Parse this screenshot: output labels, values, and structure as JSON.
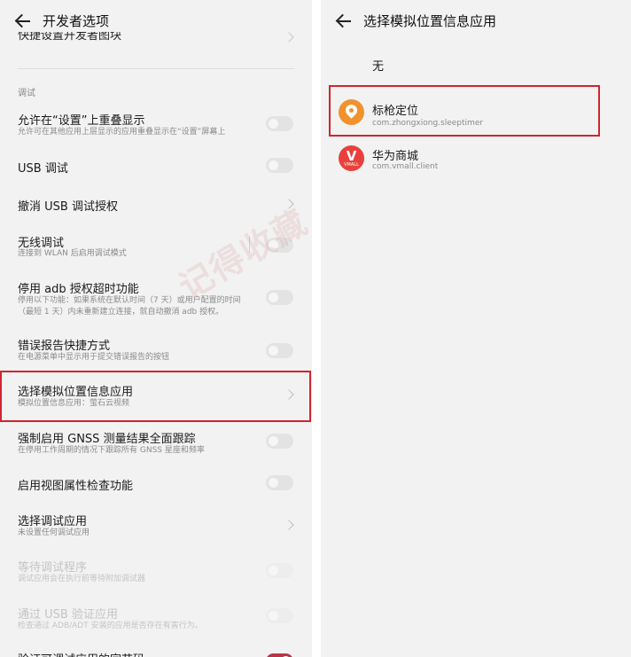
{
  "left": {
    "title": "开发者选项",
    "cut_item": "快捷设置开发者图块",
    "section": "调试",
    "rows": [
      {
        "title": "允许在“设置”上重叠显示",
        "sub": "允许可在其他应用上层显示的应用重叠显示在“设置”屏幕上",
        "control": "toggle",
        "state": "off"
      },
      {
        "title": "USB 调试",
        "control": "toggle",
        "state": "off"
      },
      {
        "title": "撤消 USB 调试授权",
        "control": "chevron"
      },
      {
        "title": "无线调试",
        "sub": "连接到 WLAN 后启用调试模式",
        "control": "toggle",
        "state": "off"
      },
      {
        "title": "停用 adb 授权超时功能",
        "sub": "停用以下功能：如果系统在默认时间（7 天）或用户配置的时间",
        "sub2": "（最短 1 天）内未重新建立连接，就自动撤消 adb 授权。",
        "control": "toggle",
        "state": "off"
      },
      {
        "title": "错误报告快捷方式",
        "sub": "在电源菜单中显示用于提交错误报告的按钮",
        "control": "toggle",
        "state": "off"
      },
      {
        "title": "选择模拟位置信息应用",
        "sub": "模拟位置信息应用：萤石云视频",
        "control": "chevron",
        "highlighted": true
      },
      {
        "title": "强制启用 GNSS 测量结果全面跟踪",
        "sub": "在停用工作周期的情况下跟踪所有 GNSS 星座和频率",
        "control": "toggle",
        "state": "off"
      },
      {
        "title": "启用视图属性检查功能",
        "control": "toggle",
        "state": "off"
      },
      {
        "title": "选择调试应用",
        "sub": "未设置任何调试应用",
        "control": "chevron"
      },
      {
        "title": "等待调试程序",
        "sub": "调试应用会在执行前等待附加调试器",
        "control": "toggle",
        "state": "off",
        "disabled": true
      },
      {
        "title": "通过 USB 验证应用",
        "sub": "检查通过 ADB/ADT 安装的应用是否存在有害行为。",
        "control": "toggle",
        "state": "off",
        "disabled": true
      },
      {
        "title": "验证可调试应用的字节码",
        "control": "toggle",
        "state": "on"
      }
    ]
  },
  "right": {
    "title": "选择模拟位置信息应用",
    "none_option": "无",
    "apps": [
      {
        "name": "标枪定位",
        "package": "com.zhongxiong.sleeptimer",
        "icon": "location-pin-icon",
        "color": "#f0922e",
        "highlighted": true
      },
      {
        "name": "华为商城",
        "package": "com.vmall.client",
        "icon": "vmall-logo-icon",
        "color": "#e8413c",
        "icon_text": "V",
        "icon_sub": "VMALL"
      }
    ]
  },
  "watermark": "记得收藏 黑域基地 Hybase.com",
  "colors": {
    "highlight_border": "#d3232e",
    "toggle_on": "#b8344a",
    "toggle_off": "#e3e3e3"
  }
}
